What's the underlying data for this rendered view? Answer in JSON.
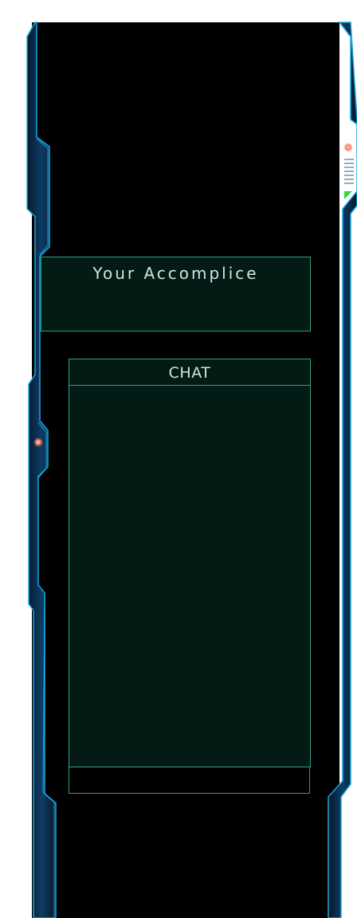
{
  "accomplice": {
    "title": "Your Accomplice"
  },
  "chat": {
    "header": "CHAT",
    "messages": [],
    "input_value": ""
  },
  "colors": {
    "frame_glow": "#1aa8e0",
    "frame_dark": "#0a2d4a",
    "panel_bg": "#041a15",
    "panel_border": "#2f9e86",
    "text": "#c9e8e0",
    "indicator_light": "#ff7a5c",
    "status_triangle": "#33d64a"
  },
  "icons": {
    "left_indicator": "status-light-icon",
    "right_indicator": "status-light-icon",
    "right_status": "green-triangle-icon"
  }
}
